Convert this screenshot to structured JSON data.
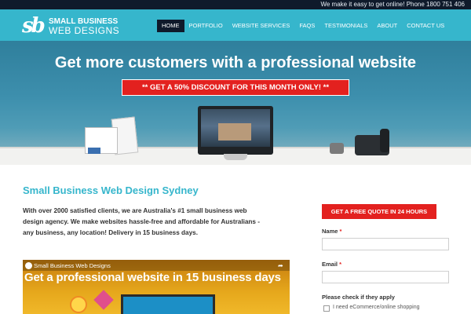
{
  "topbar": {
    "text": "We make it easy to get online!  Phone 1800 751 406"
  },
  "logo": {
    "mark": "sb",
    "line1": "SMALL BUSINESS",
    "line2": "WEB DESIGNS"
  },
  "nav": {
    "items": [
      {
        "label": "HOME",
        "active": true
      },
      {
        "label": "PORTFOLIO",
        "active": false
      },
      {
        "label": "WEBSITE SERVICES",
        "active": false
      },
      {
        "label": "FAQS",
        "active": false
      },
      {
        "label": "TESTIMONIALS",
        "active": false
      },
      {
        "label": "ABOUT",
        "active": false
      },
      {
        "label": "CONTACT US",
        "active": false
      }
    ]
  },
  "hero": {
    "title": "Get more customers with a professional website",
    "promo": "** GET A 50% DISCOUNT FOR THIS MONTH ONLY! **"
  },
  "content": {
    "heading": "Small Business Web Design Sydney",
    "intro_lines": [
      "With over 2000 satisfied clients, we are Australia's #1 small business web",
      "design agency.  We make websites hassle-free and affordable for Australians -",
      "any business, any location!  Delivery in 15 business days."
    ]
  },
  "video": {
    "channel": "Small Business Web Designs",
    "headline": "Get a professional website in 15 business days"
  },
  "form": {
    "quote_button": "GET A FREE QUOTE IN 24 HOURS",
    "name_label": "Name",
    "email_label": "Email",
    "required_mark": "*",
    "check_heading": "Please check if they apply",
    "check_option": "I need eCommerce/online shopping"
  },
  "colors": {
    "accent": "#36b6cc",
    "promo_red": "#e3211f",
    "topbar": "#0f1a2b"
  }
}
